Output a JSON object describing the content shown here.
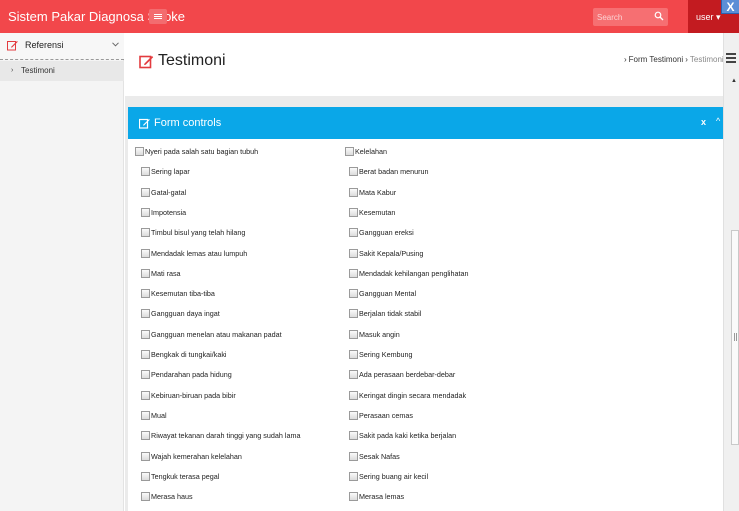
{
  "topbar": {
    "brand": "Sistem Pakar Diagnosa Stroke",
    "search_placeholder": "Search",
    "user_label": "user",
    "user_caret": "▾",
    "close_label": "X",
    "accent_color": "#f2474b",
    "user_bg_color": "#c31b20"
  },
  "sidebar": {
    "section_label": "Referensi",
    "section_icon": "edit-icon",
    "items": [
      {
        "label": "Testimoni",
        "active": true
      }
    ]
  },
  "header": {
    "title": "Testimoni",
    "title_icon": "edit-icon",
    "breadcrumb": [
      "Form Testimoni",
      "Testimoni"
    ]
  },
  "panel": {
    "title": "Form controls",
    "close_label": "x",
    "collapse_label": "^",
    "head_color": "#0aa7e8"
  },
  "symptoms_left": [
    "Nyeri pada salah satu bagian tubuh",
    "Sering lapar",
    "Gatal-gatal",
    "Impotensia",
    "Timbul bisul yang telah hilang",
    "Mendadak lemas atau lumpuh",
    "Mati rasa",
    "Kesemutan tiba-tiba",
    "Gangguan daya ingat",
    "Gangguan menelan atau makanan padat",
    "Bengkak di tungkai/kaki",
    "Pendarahan pada hidung",
    "Kebiruan-biruan pada bibir",
    "Mual",
    "Riwayat tekanan darah tinggi yang sudah lama",
    "Wajah kemerahan kelelahan",
    "Tengkuk terasa pegal",
    "Merasa haus"
  ],
  "symptoms_right": [
    "Kelelahan",
    "Berat badan menurun",
    "Mata Kabur",
    "Kesemutan",
    "Gangguan ereksi",
    "Sakit Kepala/Pusing",
    "Mendadak kehilangan penglihatan",
    "Gangguan Mental",
    "Berjalan tidak stabil",
    "Masuk angin",
    "Sering Kembung",
    "Ada perasaan berdebar-debar",
    "Keringat dingin secara mendadak",
    "Perasaan cemas",
    "Sakit pada kaki ketika berjalan",
    "Sesak Nafas",
    "Sering buang air kecil",
    "Merasa lemas"
  ]
}
